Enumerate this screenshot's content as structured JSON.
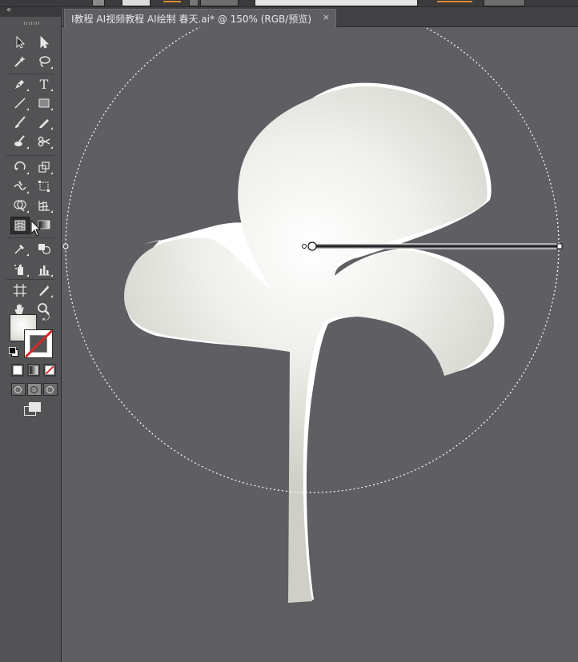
{
  "document": {
    "tab_title": "I教程 AI视频教程 AI绘制 春天.ai* @ 150% (RGB/预览)",
    "close_glyph": "×"
  },
  "tools_panel": {
    "collapse_glyph": "«",
    "tools": [
      {
        "name": "selection-tool-icon"
      },
      {
        "name": "direct-selection-tool-icon"
      },
      {
        "name": "magic-wand-tool-icon"
      },
      {
        "name": "lasso-tool-icon"
      },
      {
        "name": "pen-tool-icon"
      },
      {
        "name": "type-tool-icon",
        "glyph": "T"
      },
      {
        "name": "line-segment-tool-icon"
      },
      {
        "name": "rectangle-tool-icon"
      },
      {
        "name": "paintbrush-tool-icon"
      },
      {
        "name": "pencil-tool-icon"
      },
      {
        "name": "blob-brush-tool-icon"
      },
      {
        "name": "scissors-tool-icon"
      },
      {
        "name": "rotate-tool-icon"
      },
      {
        "name": "scale-tool-icon"
      },
      {
        "name": "warp-tool-icon"
      },
      {
        "name": "free-transform-tool-icon"
      },
      {
        "name": "shape-builder-tool-icon"
      },
      {
        "name": "perspective-grid-tool-icon"
      },
      {
        "name": "mesh-tool-icon"
      },
      {
        "name": "gradient-tool-icon"
      },
      {
        "name": "eyedropper-tool-icon"
      },
      {
        "name": "blend-tool-icon"
      },
      {
        "name": "symbol-sprayer-tool-icon"
      },
      {
        "name": "column-graph-tool-icon"
      },
      {
        "name": "artboard-tool-icon"
      },
      {
        "name": "slice-tool-icon"
      },
      {
        "name": "hand-tool-icon"
      },
      {
        "name": "zoom-tool-icon"
      }
    ],
    "fill_color": "#e8e8e4",
    "stroke_color": "none"
  },
  "colors": {
    "canvas": "#5f5e63",
    "panel": "#535355",
    "shape_light": "#ffffff",
    "shape_dark": "#c8c8c0",
    "accent_orange": "#d98a2a"
  }
}
